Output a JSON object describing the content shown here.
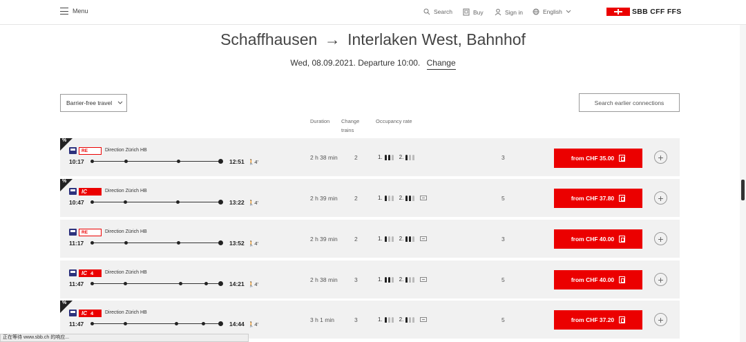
{
  "header": {
    "menu_label": "Menu",
    "search_label": "Search",
    "buy_label": "Buy",
    "signin_label": "Sign in",
    "language_label": "English",
    "logo_text": "SBB CFF FFS",
    "brand_color": "#eb0000"
  },
  "journey": {
    "from": "Schaffhausen",
    "arrow": "→",
    "to": "Interlaken West, Bahnhof",
    "date_line": "Wed, 08.09.2021. Departure 10:00.",
    "change_label": "Change"
  },
  "controls": {
    "barrier_free_label": "Barrier-free travel",
    "earlier_label": "Search earlier connections"
  },
  "columns": {
    "duration": "Duration",
    "change_trains_1": "Change",
    "change_trains_2": "trains",
    "occupancy": "Occupancy rate"
  },
  "connections": [
    {
      "corner": true,
      "train": "RE",
      "train_num": "",
      "direction": "Direction Zürich HB",
      "dep": "10:17",
      "arr": "12:51",
      "walk": "4'",
      "duration": "2 h 38 min",
      "changes": "2",
      "occ1": "1.",
      "occ2": "2.",
      "platform": "3",
      "price": "from CHF 35.00"
    },
    {
      "corner": true,
      "train": "IC",
      "train_num": "",
      "direction": "Direction Zürich HB",
      "dep": "10:47",
      "arr": "13:22",
      "walk": "4'",
      "duration": "2 h 39 min",
      "changes": "2",
      "occ1": "1.",
      "occ2": "2.",
      "platform": "5",
      "price": "from CHF 37.80"
    },
    {
      "corner": false,
      "train": "RE",
      "train_num": "",
      "direction": "Direction Zürich HB",
      "dep": "11:17",
      "arr": "13:52",
      "walk": "4'",
      "duration": "2 h 39 min",
      "changes": "2",
      "occ1": "1.",
      "occ2": "2.",
      "platform": "3",
      "price": "from CHF 40.00"
    },
    {
      "corner": false,
      "train": "IC",
      "train_num": "4",
      "direction": "Direction Zürich HB",
      "dep": "11:47",
      "arr": "14:21",
      "walk": "4'",
      "duration": "2 h 38 min",
      "changes": "3",
      "occ1": "1.",
      "occ2": "2.",
      "platform": "5",
      "price": "from CHF 40.00"
    },
    {
      "corner": true,
      "train": "IC",
      "train_num": "4",
      "direction": "Direction Zürich HB",
      "dep": "11:47",
      "arr": "14:44",
      "walk": "4'",
      "duration": "3 h 1 min",
      "changes": "3",
      "occ1": "1.",
      "occ2": "2.",
      "platform": "5",
      "price": "from CHF 37.20"
    }
  ],
  "status_bar": "正在等待 www.sbb.ch 的响应..."
}
